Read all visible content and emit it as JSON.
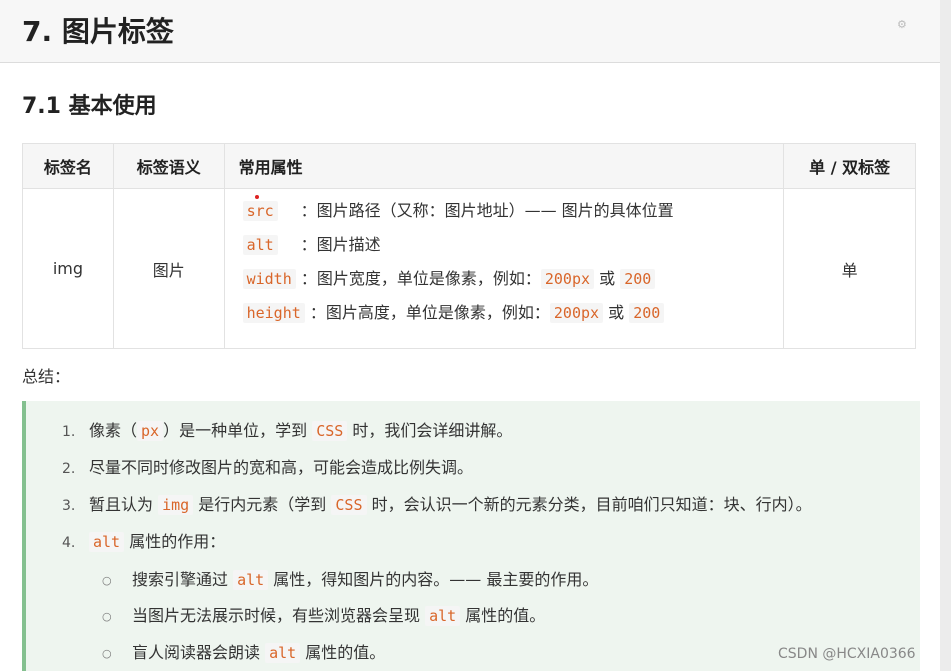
{
  "heading": "7. 图片标签",
  "subheading": "7.1 基本使用",
  "table": {
    "headers": [
      "标签名",
      "标签语义",
      "常用属性",
      "单 / 双标签"
    ],
    "row": {
      "tag": "img",
      "semantic": "图片",
      "attributes": [
        {
          "name": "src",
          "desc": "：图片路径（又称：图片地址）—— 图片的具体位置"
        },
        {
          "name": "alt",
          "desc": "：图片描述"
        },
        {
          "name": "width",
          "desc_pre": "：图片宽度，单位是像素，例如：",
          "v1": "200px",
          "or": "或",
          "v2": "200"
        },
        {
          "name": "height",
          "desc_pre": "：图片高度，单位是像素，例如：",
          "v1": "200px",
          "or": "或",
          "v2": "200"
        }
      ],
      "type": "单"
    }
  },
  "summary_label": "总结：",
  "summary": {
    "items": [
      {
        "num": "1.",
        "pre": "像素（",
        "code": "px",
        "post": "）是一种单位，学到",
        "code2": "CSS",
        "post2": "时，我们会详细讲解。"
      },
      {
        "num": "2.",
        "text": "尽量不同时修改图片的宽和高，可能会造成比例失调。"
      },
      {
        "num": "3.",
        "pre": "暂且认为",
        "code": "img",
        "post": "是行内元素（学到",
        "code2": "CSS",
        "post2": "时，会认识一个新的元素分类，目前咱们只知道：块、行内）。"
      },
      {
        "num": "4.",
        "code": "alt",
        "post": "属性的作用："
      }
    ],
    "subitems": [
      {
        "pre": "搜索引擎通过",
        "code": "alt",
        "post": "属性，得知图片的内容。—— 最主要的作用。"
      },
      {
        "pre": "当图片无法展示时候，有些浏览器会呈现",
        "code": "alt",
        "post": "属性的值。"
      },
      {
        "pre": "盲人阅读器会朗读",
        "code": "alt",
        "post": "属性的值。"
      }
    ]
  },
  "watermark": "CSDN @HCXIA0366",
  "colors": {
    "code": "#d9662a",
    "callout_bg": "#eef5ef",
    "callout_border": "#84c08f"
  }
}
